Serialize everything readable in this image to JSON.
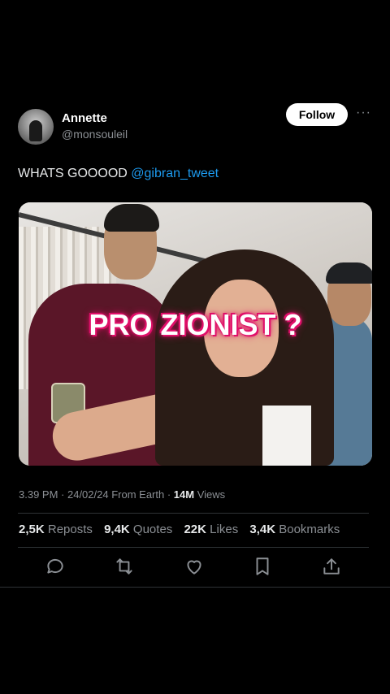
{
  "user": {
    "name": "Annette",
    "handle": "@monsouleil",
    "follow_label": "Follow",
    "more_label": "···"
  },
  "tweet": {
    "text": "WHATS GOOOOD ",
    "mention": "@gibran_tweet"
  },
  "media": {
    "overlay_text": "PRO ZIONIST ?"
  },
  "meta": {
    "time": "3.39 PM",
    "date": "24/02/24",
    "source": "From Earth",
    "views_count": "14M",
    "views_label": "Views",
    "separator": " · "
  },
  "stats": {
    "reposts_count": "2,5K",
    "reposts_label": "Reposts",
    "quotes_count": "9,4K",
    "quotes_label": "Quotes",
    "likes_count": "22K",
    "likes_label": "Likes",
    "bookmarks_count": "3,4K",
    "bookmarks_label": "Bookmarks"
  },
  "colors": {
    "background": "#000000",
    "mention": "#1d9bf0",
    "overlay_glow": "#e0116b",
    "secondary_text": "#8b8f94"
  },
  "icons": [
    "reply-icon",
    "repost-icon",
    "like-icon",
    "bookmark-icon",
    "share-icon"
  ]
}
